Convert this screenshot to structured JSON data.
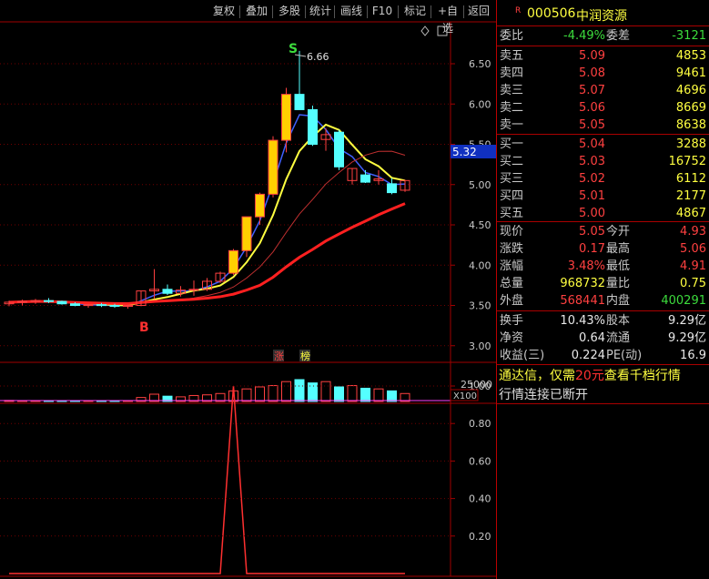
{
  "toolbar": {
    "buttons": [
      "复权",
      "叠加",
      "多股",
      "统计",
      "画线",
      "F10",
      "标记",
      "+自选",
      "返回"
    ]
  },
  "main_chart": {
    "y_ticks": [
      "6.50",
      "6.00",
      "5.50",
      "5.00",
      "4.50",
      "4.00",
      "3.50",
      "3.00"
    ],
    "price_tag": "5.32",
    "high_marker": "S",
    "high_value": "6.66",
    "buy_marker": "B",
    "zhangbang": [
      "涨",
      "榜"
    ],
    "volume_label": "25000",
    "volume_unit": "X100",
    "ind_ticks": [
      "1.00",
      "0.80",
      "0.60",
      "0.40",
      "0.20"
    ]
  },
  "chart_data": {
    "type": "candlestick",
    "candles": [
      [
        3.52,
        3.56,
        3.49,
        3.54
      ],
      [
        3.54,
        3.57,
        3.5,
        3.55
      ],
      [
        3.55,
        3.58,
        3.52,
        3.56
      ],
      [
        3.56,
        3.59,
        3.53,
        3.55
      ],
      [
        3.55,
        3.56,
        3.51,
        3.52
      ],
      [
        3.52,
        3.54,
        3.49,
        3.5
      ],
      [
        3.5,
        3.52,
        3.47,
        3.51
      ],
      [
        3.51,
        3.53,
        3.48,
        3.5
      ],
      [
        3.5,
        3.52,
        3.47,
        3.49
      ],
      [
        3.49,
        3.51,
        3.46,
        3.5
      ],
      [
        3.5,
        3.68,
        3.49,
        3.68
      ],
      [
        3.68,
        3.95,
        3.58,
        3.7
      ],
      [
        3.7,
        3.76,
        3.63,
        3.65
      ],
      [
        3.65,
        3.74,
        3.61,
        3.69
      ],
      [
        3.69,
        3.81,
        3.62,
        3.7
      ],
      [
        3.7,
        3.84,
        3.68,
        3.8
      ],
      [
        3.8,
        3.92,
        3.78,
        3.9
      ],
      [
        3.9,
        4.2,
        3.88,
        4.18
      ],
      [
        4.18,
        4.6,
        4.1,
        4.6
      ],
      [
        4.6,
        4.9,
        4.5,
        4.88
      ],
      [
        4.88,
        5.6,
        4.84,
        5.55
      ],
      [
        5.55,
        6.2,
        5.4,
        6.12
      ],
      [
        6.12,
        6.66,
        6.0,
        5.93
      ],
      [
        5.93,
        5.98,
        5.48,
        5.5
      ],
      [
        5.56,
        5.7,
        5.42,
        5.62
      ],
      [
        5.65,
        5.68,
        5.18,
        5.22
      ],
      [
        5.05,
        5.2,
        5.0,
        5.2
      ],
      [
        5.12,
        5.18,
        5.02,
        5.03
      ],
      [
        5.05,
        5.18,
        5.0,
        5.07
      ],
      [
        5.01,
        5.08,
        4.88,
        4.9
      ],
      [
        4.93,
        5.06,
        4.91,
        5.05
      ]
    ],
    "volumes": [
      8,
      6,
      5,
      7,
      6,
      5,
      4,
      5,
      6,
      5,
      30,
      55,
      40,
      35,
      45,
      50,
      60,
      80,
      95,
      110,
      120,
      150,
      165,
      140,
      150,
      110,
      120,
      100,
      95,
      80,
      60
    ],
    "indicator_peak_index": 17,
    "indicator_peak_value": 1.0
  },
  "quote": {
    "code": "000506",
    "name": "中润资源",
    "r_mark": "R",
    "weibi_label": "委比",
    "weibi": "-4.49%",
    "weicha_label": "委差",
    "weicha": "-3121",
    "sell": [
      {
        "label": "卖五",
        "price": "5.09",
        "vol": "4853"
      },
      {
        "label": "卖四",
        "price": "5.08",
        "vol": "9461"
      },
      {
        "label": "卖三",
        "price": "5.07",
        "vol": "4696"
      },
      {
        "label": "卖二",
        "price": "5.06",
        "vol": "8669"
      },
      {
        "label": "卖一",
        "price": "5.05",
        "vol": "8638"
      }
    ],
    "buy": [
      {
        "label": "买一",
        "price": "5.04",
        "vol": "3288"
      },
      {
        "label": "买二",
        "price": "5.03",
        "vol": "16752"
      },
      {
        "label": "买三",
        "price": "5.02",
        "vol": "6112"
      },
      {
        "label": "买四",
        "price": "5.01",
        "vol": "2177"
      },
      {
        "label": "买五",
        "price": "5.00",
        "vol": "4867"
      }
    ],
    "stats": [
      {
        "l1": "现价",
        "v1": "5.05",
        "c1": "red",
        "l2": "今开",
        "v2": "4.93",
        "c2": "red"
      },
      {
        "l1": "涨跌",
        "v1": "0.17",
        "c1": "red",
        "l2": "最高",
        "v2": "5.06",
        "c2": "red"
      },
      {
        "l1": "涨幅",
        "v1": "3.48%",
        "c1": "red",
        "l2": "最低",
        "v2": "4.91",
        "c2": "red"
      },
      {
        "l1": "总量",
        "v1": "968732",
        "c1": "yellow",
        "l2": "量比",
        "v2": "0.75",
        "c2": "yellow"
      },
      {
        "l1": "外盘",
        "v1": "568441",
        "c1": "red",
        "l2": "内盘",
        "v2": "400291",
        "c2": "green"
      }
    ],
    "fin": [
      {
        "l1": "换手",
        "v1": "10.43%",
        "l2": "股本",
        "v2": "9.29亿"
      },
      {
        "l1": "净资",
        "v1": "0.64",
        "l2": "流通",
        "v2": "9.29亿"
      },
      {
        "l1": "收益(三)",
        "v1": "0.224",
        "l2": "PE(动)",
        "v2": "16.9"
      }
    ],
    "notice_a": "通达信，仅需",
    "notice_b": "20元",
    "notice_c": "查看千档行情",
    "conn_status": "行情连接已断开"
  },
  "colors": {
    "up": "#ff4040",
    "down": "#54ffff",
    "ma_short": "#ffff40",
    "ma_mid": "#4060ff",
    "ma_long": "#ff2020",
    "grid": "#800000"
  }
}
